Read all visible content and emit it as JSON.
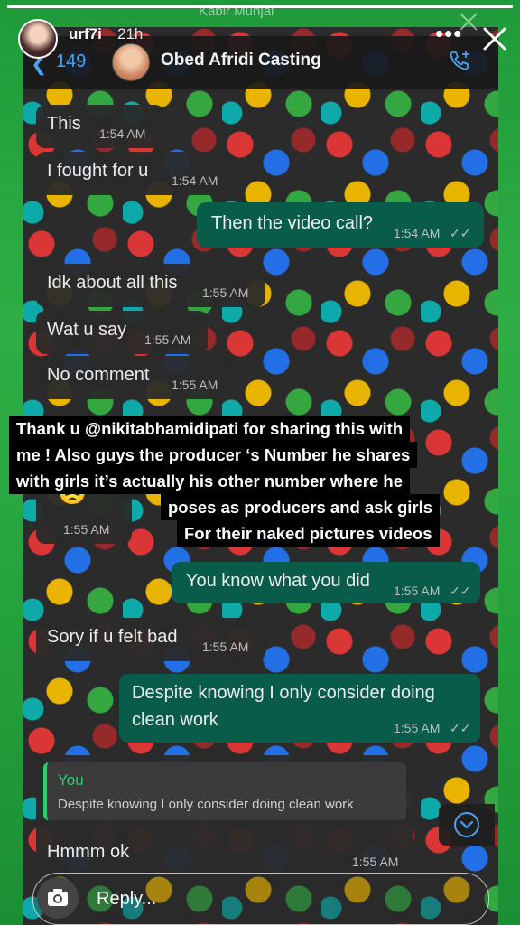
{
  "ghost_header": {
    "title": "Kabir Munjal"
  },
  "story": {
    "username": "urf7i",
    "time": "21h",
    "more": "•••"
  },
  "chat_header": {
    "back_count": "149",
    "contact_name": "Obed Afridi Casting"
  },
  "messages": [
    {
      "text": "This",
      "time": "1:54 AM",
      "dir": "in"
    },
    {
      "text": "I fought for u",
      "time": "1:54 AM",
      "dir": "in"
    },
    {
      "text": "Then the video call?",
      "time": "1:54 AM",
      "dir": "out"
    },
    {
      "text": "Idk about all this",
      "time": "1:55 AM",
      "dir": "in"
    },
    {
      "text": "Wat u say",
      "time": "1:55 AM",
      "dir": "in"
    },
    {
      "text": "No comment",
      "time": "1:55 AM",
      "dir": "in"
    },
    {
      "text": "1:55 AM",
      "time": "1:55 AM",
      "dir": "in"
    },
    {
      "text": "You know what you did",
      "time": "1:55 AM",
      "dir": "out"
    },
    {
      "text": "Sory if u felt bad",
      "time": "1:55 AM",
      "dir": "in"
    },
    {
      "text": "Despite knowing I only consider doing",
      "text2": "clean work",
      "time": "1:55 AM",
      "dir": "out"
    },
    {
      "text": "Hmmm ok",
      "time": "1:55 AM",
      "dir": "in",
      "quote": {
        "who": "You",
        "text": "Despite knowing I only consider doing clean work"
      }
    }
  ],
  "caption": [
    "Thank u @nikitabhamidipati  for sharing this with",
    "me ! Also guys the producer ‘s Number he shares",
    "with girls it’s actually his other number where he",
    "poses as producers and ask girls",
    "For their naked pictures videos"
  ],
  "reply_bar": {
    "label": "Reply..."
  },
  "colors": {
    "accent": "#25d366",
    "outgoing": "#0a5c4a",
    "link": "#4aa3f0",
    "story_bg": "#2fae45"
  },
  "icons": [
    "chevron-left-icon",
    "call-add-icon",
    "close-icon",
    "camera-icon",
    "chevron-down-icon",
    "emoji-icon",
    "read-ticks-icon"
  ]
}
